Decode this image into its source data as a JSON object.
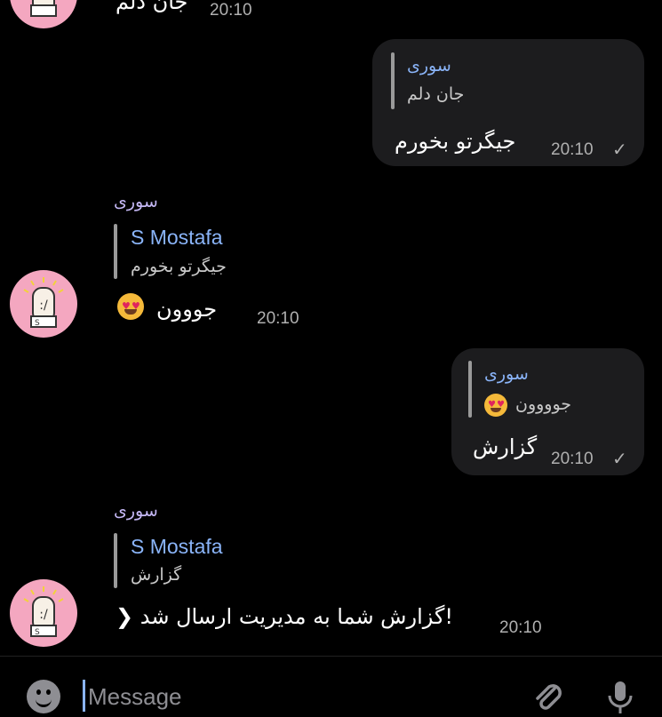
{
  "messages": [
    {
      "text": "جان دلم",
      "time": "20:10"
    },
    {
      "reply_name": "سوری",
      "reply_text": "جان دلم",
      "text": "جیگرتو بخورم",
      "time": "20:10"
    },
    {
      "sender": "سوری",
      "reply_name": "S Mostafa",
      "reply_text": "جیگرتو بخورم",
      "text": "جووون",
      "time": "20:10"
    },
    {
      "reply_name": "سوری",
      "reply_text": "جوووون",
      "text": "گزارش",
      "time": "20:10"
    },
    {
      "sender": "سوری",
      "reply_name": "S Mostafa",
      "reply_text": "گزارش",
      "text": "❯ گزارش شما به مدیریت ارسال شد!",
      "time": "20:10"
    }
  ],
  "composer": {
    "placeholder": "Message"
  },
  "icons": {
    "emoji": "emoji-icon",
    "attach": "paperclip-icon",
    "mic": "microphone-icon",
    "read": "check-icon"
  },
  "colors": {
    "background": "#000000",
    "bubble": "#1c1c1e",
    "accent": "#8ab4f8",
    "sender": "#c5b8f5",
    "avatar": "#f4a7c0"
  }
}
